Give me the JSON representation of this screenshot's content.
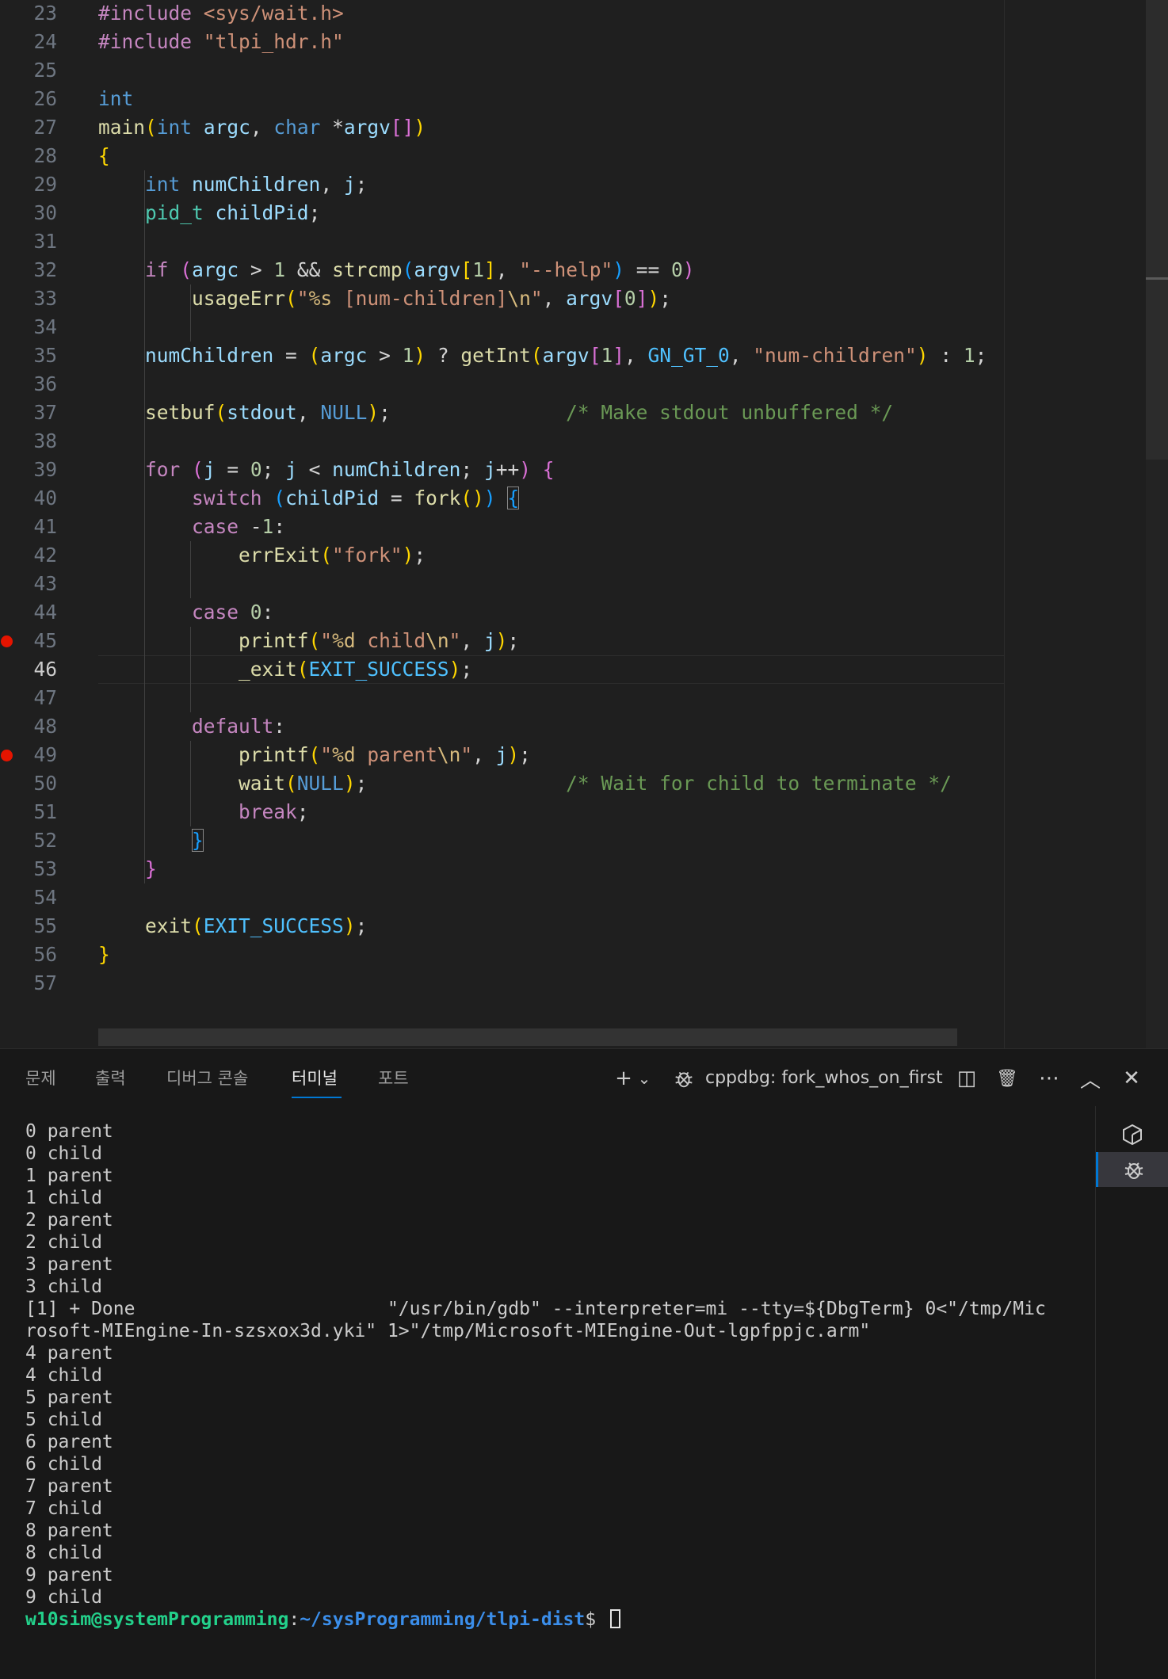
{
  "editor": {
    "active_line": 46,
    "breakpoint_lines": [
      45,
      49
    ],
    "lines": [
      {
        "n": 23,
        "t": [
          [
            "t-pre",
            "#include "
          ],
          [
            "t-str",
            "<sys/wait.h>"
          ]
        ]
      },
      {
        "n": 24,
        "t": [
          [
            "t-pre",
            "#include "
          ],
          [
            "t-str",
            "\"tlpi_hdr.h\""
          ]
        ]
      },
      {
        "n": 25,
        "t": []
      },
      {
        "n": 26,
        "t": [
          [
            "t-kw",
            "int"
          ]
        ]
      },
      {
        "n": 27,
        "t": [
          [
            "t-fn",
            "main"
          ],
          [
            "t-b1",
            "("
          ],
          [
            "t-kw",
            "int"
          ],
          [
            "",
            " "
          ],
          [
            "t-var",
            "argc"
          ],
          [
            "t-op",
            ", "
          ],
          [
            "t-kw",
            "char"
          ],
          [
            "t-op",
            " *"
          ],
          [
            "t-var",
            "argv"
          ],
          [
            "t-b2",
            "[]"
          ],
          [
            "t-b1",
            ")"
          ]
        ]
      },
      {
        "n": 28,
        "t": [
          [
            "t-b1",
            "{"
          ]
        ]
      },
      {
        "n": 29,
        "t": [
          [
            "",
            "    "
          ],
          [
            "t-kw",
            "int"
          ],
          [
            "",
            " "
          ],
          [
            "t-var",
            "numChildren"
          ],
          [
            "t-op",
            ", "
          ],
          [
            "t-var",
            "j"
          ],
          [
            "t-op",
            ";"
          ]
        ]
      },
      {
        "n": 30,
        "t": [
          [
            "",
            "    "
          ],
          [
            "t-type",
            "pid_t"
          ],
          [
            "",
            " "
          ],
          [
            "t-var",
            "childPid"
          ],
          [
            "t-op",
            ";"
          ]
        ]
      },
      {
        "n": 31,
        "t": []
      },
      {
        "n": 32,
        "t": [
          [
            "",
            "    "
          ],
          [
            "t-ctl",
            "if"
          ],
          [
            "",
            " "
          ],
          [
            "t-b2",
            "("
          ],
          [
            "t-var",
            "argc"
          ],
          [
            "t-op",
            " > "
          ],
          [
            "t-num",
            "1"
          ],
          [
            "t-op",
            " && "
          ],
          [
            "t-fn",
            "strcmp"
          ],
          [
            "t-b3",
            "("
          ],
          [
            "t-var",
            "argv"
          ],
          [
            "t-b1",
            "["
          ],
          [
            "t-num",
            "1"
          ],
          [
            "t-b1",
            "]"
          ],
          [
            "t-op",
            ", "
          ],
          [
            "t-str",
            "\"--help\""
          ],
          [
            "t-b3",
            ")"
          ],
          [
            "t-op",
            " == "
          ],
          [
            "t-num",
            "0"
          ],
          [
            "t-b2",
            ")"
          ]
        ]
      },
      {
        "n": 33,
        "t": [
          [
            "",
            "        "
          ],
          [
            "t-fn",
            "usageErr"
          ],
          [
            "t-b1",
            "("
          ],
          [
            "t-str",
            "\""
          ],
          [
            "t-esc",
            "%s"
          ],
          [
            "t-str",
            " [num-children]"
          ],
          [
            "t-esc",
            "\\n"
          ],
          [
            "t-str",
            "\""
          ],
          [
            "t-op",
            ", "
          ],
          [
            "t-var",
            "argv"
          ],
          [
            "t-b2",
            "["
          ],
          [
            "t-num",
            "0"
          ],
          [
            "t-b2",
            "]"
          ],
          [
            "t-b1",
            ")"
          ],
          [
            "t-op",
            ";"
          ]
        ]
      },
      {
        "n": 34,
        "t": []
      },
      {
        "n": 35,
        "t": [
          [
            "",
            "    "
          ],
          [
            "t-var",
            "numChildren"
          ],
          [
            "t-op",
            " = "
          ],
          [
            "t-b1",
            "("
          ],
          [
            "t-var",
            "argc"
          ],
          [
            "t-op",
            " > "
          ],
          [
            "t-num",
            "1"
          ],
          [
            "t-b1",
            ")"
          ],
          [
            "t-op",
            " ? "
          ],
          [
            "t-fn",
            "getInt"
          ],
          [
            "t-b1",
            "("
          ],
          [
            "t-var",
            "argv"
          ],
          [
            "t-b2",
            "["
          ],
          [
            "t-num",
            "1"
          ],
          [
            "t-b2",
            "]"
          ],
          [
            "t-op",
            ", "
          ],
          [
            "t-mac",
            "GN_GT_0"
          ],
          [
            "t-op",
            ", "
          ],
          [
            "t-str",
            "\"num-children\""
          ],
          [
            "t-b1",
            ")"
          ],
          [
            "t-op",
            " : "
          ],
          [
            "t-num",
            "1"
          ],
          [
            "t-op",
            ";"
          ]
        ]
      },
      {
        "n": 36,
        "t": []
      },
      {
        "n": 37,
        "t": [
          [
            "",
            "    "
          ],
          [
            "t-fn",
            "setbuf"
          ],
          [
            "t-b1",
            "("
          ],
          [
            "t-var",
            "stdout"
          ],
          [
            "t-op",
            ", "
          ],
          [
            "t-kw",
            "NULL"
          ],
          [
            "t-b1",
            ")"
          ],
          [
            "t-op",
            ";"
          ],
          [
            "",
            "               "
          ],
          [
            "t-cmt",
            "/* Make stdout unbuffered */"
          ]
        ]
      },
      {
        "n": 38,
        "t": []
      },
      {
        "n": 39,
        "t": [
          [
            "",
            "    "
          ],
          [
            "t-ctl",
            "for"
          ],
          [
            "",
            " "
          ],
          [
            "t-b2",
            "("
          ],
          [
            "t-var",
            "j"
          ],
          [
            "t-op",
            " = "
          ],
          [
            "t-num",
            "0"
          ],
          [
            "t-op",
            "; "
          ],
          [
            "t-var",
            "j"
          ],
          [
            "t-op",
            " < "
          ],
          [
            "t-var",
            "numChildren"
          ],
          [
            "t-op",
            "; "
          ],
          [
            "t-var",
            "j"
          ],
          [
            "t-op",
            "++"
          ],
          [
            "t-b2",
            ")"
          ],
          [
            "",
            " "
          ],
          [
            "t-b2",
            "{"
          ]
        ]
      },
      {
        "n": 40,
        "t": [
          [
            "",
            "        "
          ],
          [
            "t-ctl",
            "switch"
          ],
          [
            "",
            " "
          ],
          [
            "t-b3",
            "("
          ],
          [
            "t-var",
            "childPid"
          ],
          [
            "t-op",
            " = "
          ],
          [
            "t-fn",
            "fork"
          ],
          [
            "t-b1",
            "()"
          ],
          [
            "t-b3",
            ")"
          ],
          [
            "",
            " "
          ],
          [
            "t-b3 box",
            "{"
          ]
        ]
      },
      {
        "n": 41,
        "t": [
          [
            "",
            "        "
          ],
          [
            "t-ctl",
            "case"
          ],
          [
            "t-op",
            " -"
          ],
          [
            "t-num",
            "1"
          ],
          [
            "t-op",
            ":"
          ]
        ]
      },
      {
        "n": 42,
        "t": [
          [
            "",
            "            "
          ],
          [
            "t-fn",
            "errExit"
          ],
          [
            "t-b1",
            "("
          ],
          [
            "t-str",
            "\"fork\""
          ],
          [
            "t-b1",
            ")"
          ],
          [
            "t-op",
            ";"
          ]
        ]
      },
      {
        "n": 43,
        "t": []
      },
      {
        "n": 44,
        "t": [
          [
            "",
            "        "
          ],
          [
            "t-ctl",
            "case"
          ],
          [
            "",
            " "
          ],
          [
            "t-num",
            "0"
          ],
          [
            "t-op",
            ":"
          ]
        ]
      },
      {
        "n": 45,
        "t": [
          [
            "",
            "            "
          ],
          [
            "t-fn",
            "printf"
          ],
          [
            "t-b1",
            "("
          ],
          [
            "t-str",
            "\""
          ],
          [
            "t-esc",
            "%d"
          ],
          [
            "t-str",
            " child"
          ],
          [
            "t-esc",
            "\\n"
          ],
          [
            "t-str",
            "\""
          ],
          [
            "t-op",
            ", "
          ],
          [
            "t-var",
            "j"
          ],
          [
            "t-b1",
            ")"
          ],
          [
            "t-op",
            ";"
          ]
        ]
      },
      {
        "n": 46,
        "t": [
          [
            "",
            "            "
          ],
          [
            "t-fn",
            "_exit"
          ],
          [
            "t-b1",
            "("
          ],
          [
            "t-mac",
            "EXIT_SUCCESS"
          ],
          [
            "t-b1",
            ")"
          ],
          [
            "t-op",
            ";"
          ]
        ]
      },
      {
        "n": 47,
        "t": []
      },
      {
        "n": 48,
        "t": [
          [
            "",
            "        "
          ],
          [
            "t-ctl",
            "default"
          ],
          [
            "t-op",
            ":"
          ]
        ]
      },
      {
        "n": 49,
        "t": [
          [
            "",
            "            "
          ],
          [
            "t-fn",
            "printf"
          ],
          [
            "t-b1",
            "("
          ],
          [
            "t-str",
            "\""
          ],
          [
            "t-esc",
            "%d"
          ],
          [
            "t-str",
            " parent"
          ],
          [
            "t-esc",
            "\\n"
          ],
          [
            "t-str",
            "\""
          ],
          [
            "t-op",
            ", "
          ],
          [
            "t-var",
            "j"
          ],
          [
            "t-b1",
            ")"
          ],
          [
            "t-op",
            ";"
          ]
        ]
      },
      {
        "n": 50,
        "t": [
          [
            "",
            "            "
          ],
          [
            "t-fn",
            "wait"
          ],
          [
            "t-b1",
            "("
          ],
          [
            "t-kw",
            "NULL"
          ],
          [
            "t-b1",
            ")"
          ],
          [
            "t-op",
            ";"
          ],
          [
            "",
            "                 "
          ],
          [
            "t-cmt",
            "/* Wait for child to terminate */"
          ]
        ]
      },
      {
        "n": 51,
        "t": [
          [
            "",
            "            "
          ],
          [
            "t-ctl",
            "break"
          ],
          [
            "t-op",
            ";"
          ]
        ]
      },
      {
        "n": 52,
        "t": [
          [
            "",
            "        "
          ],
          [
            "t-b3 box",
            "}"
          ]
        ]
      },
      {
        "n": 53,
        "t": [
          [
            "",
            "    "
          ],
          [
            "t-b2",
            "}"
          ]
        ]
      },
      {
        "n": 54,
        "t": []
      },
      {
        "n": 55,
        "t": [
          [
            "",
            "    "
          ],
          [
            "t-fn",
            "exit"
          ],
          [
            "t-b1",
            "("
          ],
          [
            "t-mac",
            "EXIT_SUCCESS"
          ],
          [
            "t-b1",
            ")"
          ],
          [
            "t-op",
            ";"
          ]
        ]
      },
      {
        "n": 56,
        "t": [
          [
            "t-b1",
            "}"
          ]
        ]
      },
      {
        "n": 57,
        "t": []
      }
    ]
  },
  "panel": {
    "tabs": [
      {
        "label": "문제",
        "name": "tab-problems"
      },
      {
        "label": "출력",
        "name": "tab-output"
      },
      {
        "label": "디버그 콘솔",
        "name": "tab-debug-console"
      },
      {
        "label": "터미널",
        "name": "tab-terminal",
        "active": true
      },
      {
        "label": "포트",
        "name": "tab-ports"
      }
    ],
    "terminal_name": "cppdbg: fork_whos_on_first",
    "actions": [
      {
        "name": "new-terminal-icon",
        "glyph": "+"
      },
      {
        "name": "terminal-dropdown-chevron-icon",
        "glyph": "⌄"
      },
      {
        "name": "split-terminal-icon",
        "glyph": "◫"
      },
      {
        "name": "kill-terminal-trash-icon",
        "glyph": "🗑"
      },
      {
        "name": "more-actions-icon",
        "glyph": "⋯"
      },
      {
        "name": "maximize-panel-chevron-up-icon",
        "glyph": "︿"
      },
      {
        "name": "close-panel-icon",
        "glyph": "✕"
      }
    ]
  },
  "terminal": {
    "lines": [
      "0 parent",
      "0 child",
      "1 parent",
      "1 child",
      "2 parent",
      "2 child",
      "3 parent",
      "3 child",
      "[1] + Done                       \"/usr/bin/gdb\" --interpreter=mi --tty=${DbgTerm} 0<\"/tmp/Mic",
      "rosoft-MIEngine-In-szsxox3d.yki\" 1>\"/tmp/Microsoft-MIEngine-Out-lgpfppjc.arm\"",
      "4 parent",
      "4 child",
      "5 parent",
      "5 child",
      "6 parent",
      "6 child",
      "7 parent",
      "7 child",
      "8 parent",
      "8 child",
      "9 parent",
      "9 child"
    ],
    "prompt_user": "w10sim@systemProgramming",
    "prompt_sep": ":",
    "prompt_path": "~/sysProgramming/tlpi-dist",
    "prompt_symbol": "$ "
  }
}
